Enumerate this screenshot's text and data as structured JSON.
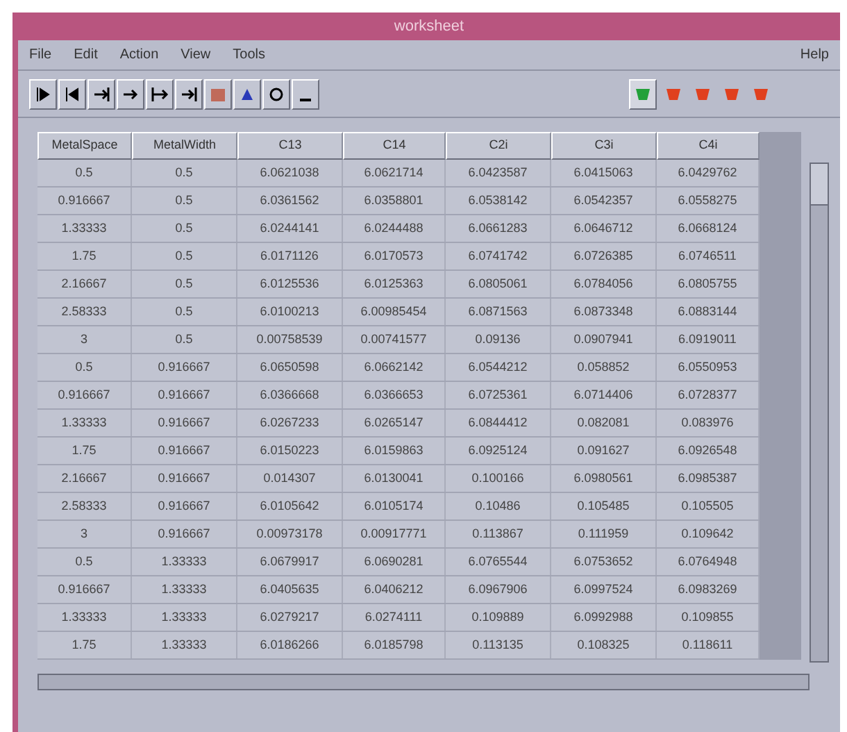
{
  "window": {
    "title": "worksheet"
  },
  "menu": [
    "File",
    "Edit",
    "Action",
    "View",
    "Tools"
  ],
  "help": "Help",
  "toolbar": {
    "buttons": [
      {
        "kind": "play"
      },
      {
        "kind": "back"
      },
      {
        "kind": "step"
      },
      {
        "kind": "forward"
      },
      {
        "kind": "jump"
      },
      {
        "kind": "end"
      },
      {
        "kind": "square"
      },
      {
        "kind": "triangle"
      },
      {
        "kind": "circle"
      },
      {
        "kind": "dash"
      }
    ],
    "lights": [
      {
        "color": "#22a03a",
        "selected": true
      },
      {
        "color": "#e0401e",
        "selected": false
      },
      {
        "color": "#e0401e",
        "selected": false
      },
      {
        "color": "#e0401e",
        "selected": false
      },
      {
        "color": "#e0401e",
        "selected": false
      }
    ]
  },
  "table": {
    "columns": [
      "MetalSpace",
      "MetalWidth",
      "C13",
      "C14",
      "C2i",
      "C3i",
      "C4i"
    ],
    "rows": [
      [
        "0.5",
        "0.5",
        "6.0621038",
        "6.0621714",
        "6.0423587",
        "6.0415063",
        "6.0429762"
      ],
      [
        "0.916667",
        "0.5",
        "6.0361562",
        "6.0358801",
        "6.0538142",
        "6.0542357",
        "6.0558275"
      ],
      [
        "1.33333",
        "0.5",
        "6.0244141",
        "6.0244488",
        "6.0661283",
        "6.0646712",
        "6.0668124"
      ],
      [
        "1.75",
        "0.5",
        "6.0171126",
        "6.0170573",
        "6.0741742",
        "6.0726385",
        "6.0746511"
      ],
      [
        "2.16667",
        "0.5",
        "6.0125536",
        "6.0125363",
        "6.0805061",
        "6.0784056",
        "6.0805755"
      ],
      [
        "2.58333",
        "0.5",
        "6.0100213",
        "6.00985454",
        "6.0871563",
        "6.0873348",
        "6.0883144"
      ],
      [
        "3",
        "0.5",
        "0.00758539",
        "0.00741577",
        "0.09136",
        "0.0907941",
        "6.0919011"
      ],
      [
        "0.5",
        "0.916667",
        "6.0650598",
        "6.0662142",
        "6.0544212",
        "0.058852",
        "6.0550953"
      ],
      [
        "0.916667",
        "0.916667",
        "6.0366668",
        "6.0366653",
        "6.0725361",
        "6.0714406",
        "6.0728377"
      ],
      [
        "1.33333",
        "0.916667",
        "6.0267233",
        "6.0265147",
        "6.0844412",
        "0.082081",
        "0.083976"
      ],
      [
        "1.75",
        "0.916667",
        "6.0150223",
        "6.0159863",
        "6.0925124",
        "0.091627",
        "6.0926548"
      ],
      [
        "2.16667",
        "0.916667",
        "0.014307",
        "6.0130041",
        "0.100166",
        "6.0980561",
        "6.0985387"
      ],
      [
        "2.58333",
        "0.916667",
        "6.0105642",
        "6.0105174",
        "0.10486",
        "0.105485",
        "0.105505"
      ],
      [
        "3",
        "0.916667",
        "0.00973178",
        "0.00917771",
        "0.113867",
        "0.111959",
        "0.109642"
      ],
      [
        "0.5",
        "1.33333",
        "6.0679917",
        "6.0690281",
        "6.0765544",
        "6.0753652",
        "6.0764948"
      ],
      [
        "0.916667",
        "1.33333",
        "6.0405635",
        "6.0406212",
        "6.0967906",
        "6.0997524",
        "6.0983269"
      ],
      [
        "1.33333",
        "1.33333",
        "6.0279217",
        "6.0274111",
        "0.109889",
        "6.0992988",
        "0.109855"
      ],
      [
        "1.75",
        "1.33333",
        "6.0186266",
        "6.0185798",
        "0.113135",
        "0.108325",
        "0.118611"
      ]
    ]
  }
}
